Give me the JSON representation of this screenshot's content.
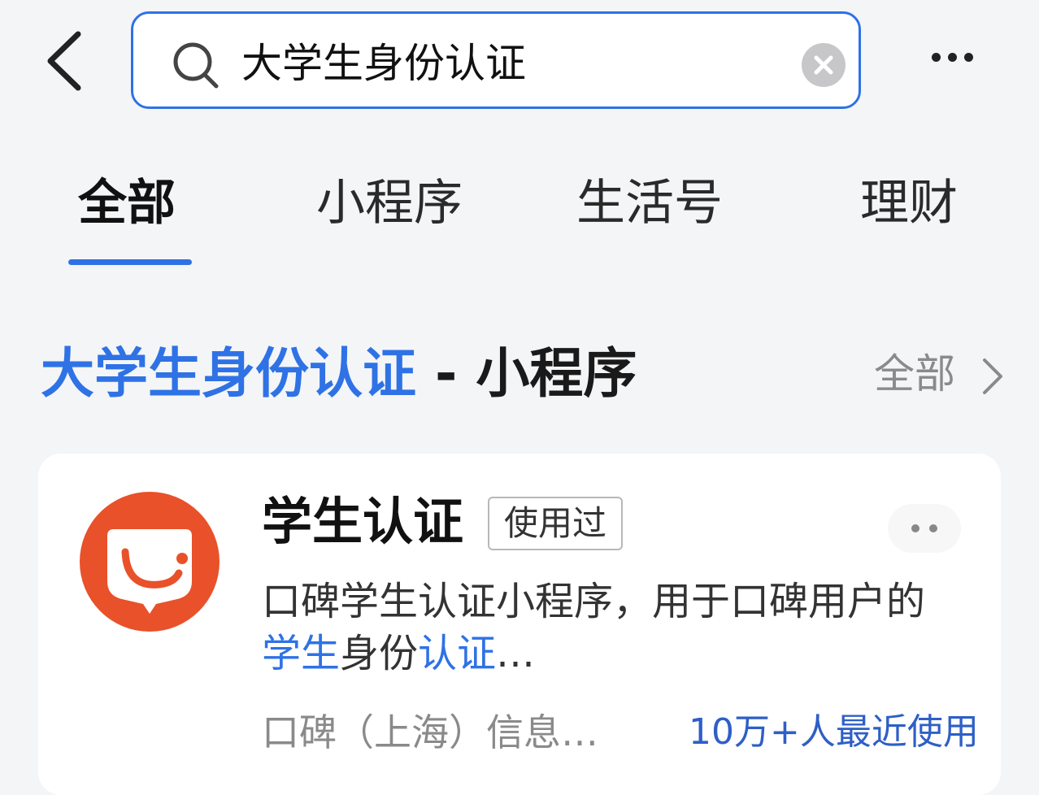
{
  "search": {
    "query": "大学生身份认证"
  },
  "tabs": [
    {
      "label": "全部",
      "active": true
    },
    {
      "label": "小程序",
      "active": false
    },
    {
      "label": "生活号",
      "active": false
    },
    {
      "label": "理财",
      "active": false
    }
  ],
  "section": {
    "title_highlight": "大学生身份认证",
    "title_rest": " - 小程序",
    "see_all": "全部"
  },
  "result": {
    "name": "学生认证",
    "badge": "使用过",
    "desc_1": "口碑学生认证小程序，用于口碑用户的",
    "desc_hl_1": "学生",
    "desc_2": "身份",
    "desc_hl_2": "认证",
    "desc_3": "…",
    "provider": "口碑（上海）信息…",
    "usage": "10万+人最近使用",
    "icon": "smile-logo-icon"
  },
  "icons": {
    "back": "chevron-left-icon",
    "search": "search-icon",
    "clear": "clear-icon",
    "more": "more-icon",
    "see_all_arrow": "chevron-right-icon"
  },
  "colors": {
    "accent": "#2e72e6",
    "logo": "#e8512a",
    "background": "#f4f5f7"
  }
}
